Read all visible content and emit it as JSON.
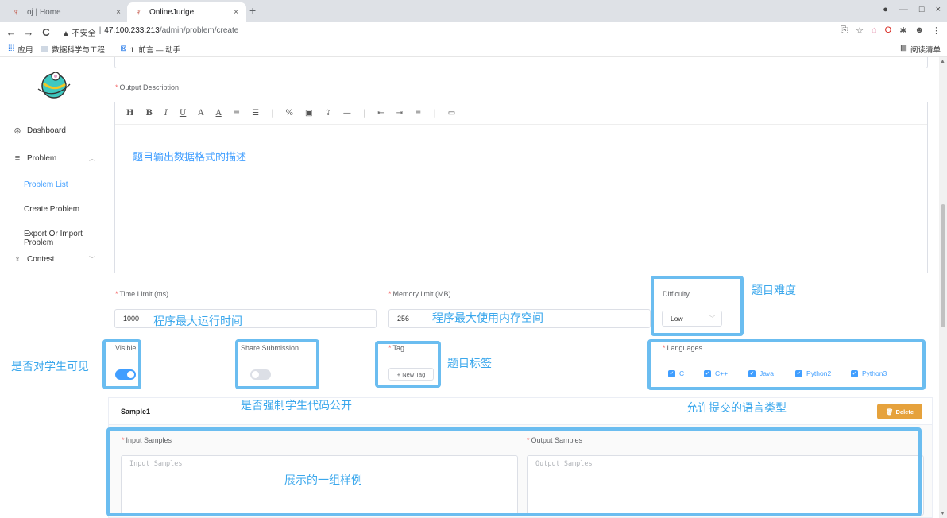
{
  "browser": {
    "tabs": [
      {
        "title": "oj | Home",
        "close": "×"
      },
      {
        "title": "OnlineJudge",
        "close": "×"
      }
    ],
    "new_tab": "+",
    "nav": {
      "back": "←",
      "forward": "→",
      "reload": "C"
    },
    "url": {
      "warning": "▲ 不安全",
      "divider": "|",
      "host": "47.100.233.213",
      "path": "/admin/problem/create"
    },
    "bookmarks": [
      {
        "label": "应用"
      },
      {
        "label": "数据科学与工程…"
      },
      {
        "label": "1. 前言 — 动手…"
      }
    ],
    "reading_list": "阅读清单",
    "window_controls": [
      "—",
      "□",
      "×"
    ]
  },
  "sidebar": {
    "items": [
      {
        "label": "Dashboard"
      },
      {
        "label": "Problem"
      },
      {
        "label": "Contest"
      }
    ],
    "sub_items": [
      {
        "label": "Problem List",
        "active": true
      },
      {
        "label": "Create Problem"
      },
      {
        "label": "Export Or Import Problem"
      }
    ]
  },
  "form": {
    "output_description_label": "Output Description",
    "toolbar": [
      "H",
      "B",
      "I",
      "U",
      "A",
      "A",
      "≡",
      "☰",
      "|",
      "%",
      "▣",
      "⇪",
      "—",
      "|",
      "⇤",
      "⇥",
      "≡",
      "|",
      "▭"
    ],
    "editor_text": "题目输出数据格式的描述",
    "time_limit_label": "Time Limit (ms)",
    "time_limit_value": "1000",
    "memory_limit_label": "Memory limit (MB)",
    "memory_limit_value": "256",
    "difficulty_label": "Difficulty",
    "difficulty_value": "Low",
    "visible_label": "Visible",
    "visible_on": true,
    "share_submission_label": "Share Submission",
    "share_submission_on": false,
    "tag_label": "Tag",
    "new_tag_button": "+ New Tag",
    "languages_label": "Languages",
    "languages": [
      "C",
      "C++",
      "Java",
      "Python2",
      "Python3"
    ],
    "sample_title": "Sample1",
    "delete_button": "Delete",
    "input_samples_label": "Input Samples",
    "input_samples_placeholder": "Input Samples",
    "output_samples_label": "Output Samples",
    "output_samples_placeholder": "Output Samples",
    "required_mark": "*"
  },
  "annotations": {
    "time_limit": "程序最大运行时间",
    "memory_limit": "程序最大使用内存空间",
    "difficulty": "题目难度",
    "visible": "是否对学生可见",
    "share_submission": "是否强制学生代码公开",
    "tag": "题目标签",
    "languages": "允许提交的语言类型",
    "samples": "展示的一组样例"
  },
  "colors": {
    "primary": "#409eff",
    "annotation": "#6bbdf0",
    "delete": "#e6a23c",
    "required": "#f56c6c"
  }
}
